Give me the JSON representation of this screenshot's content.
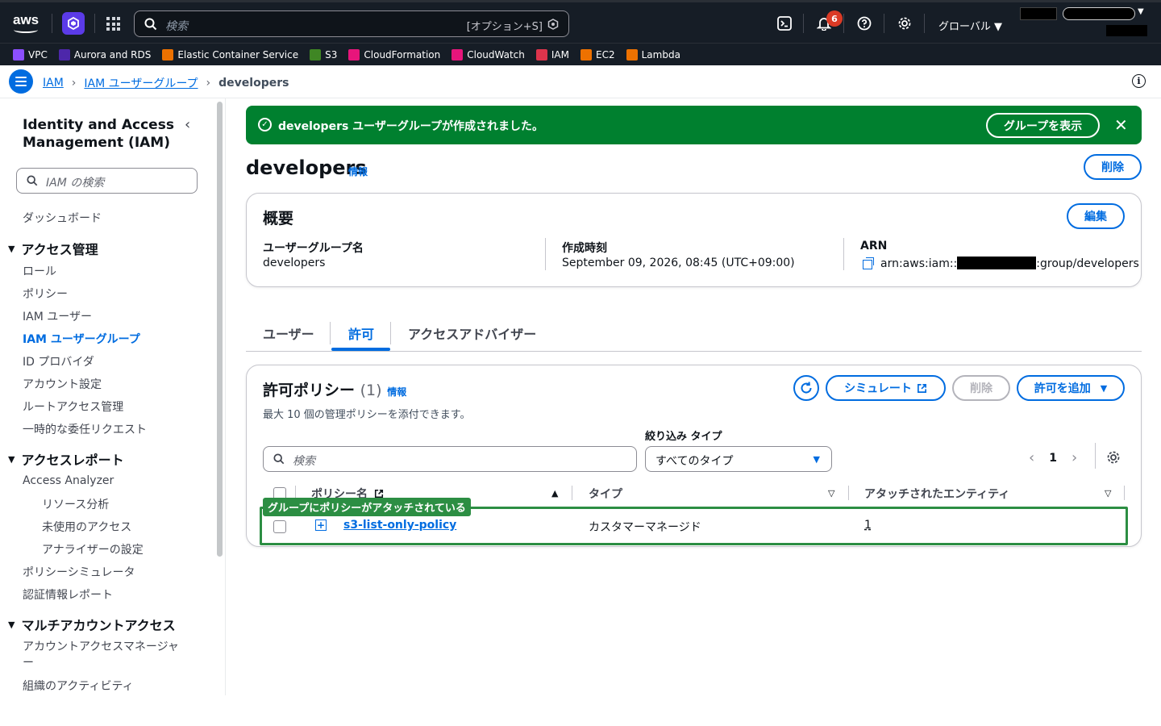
{
  "topbar": {
    "logo_text": "aws",
    "search_placeholder": "検索",
    "search_shortcut": "[オプション+S]",
    "notifications_count": "6",
    "region": "グローバル ▼"
  },
  "favorites": [
    {
      "label": "VPC",
      "color": "#8c4fff"
    },
    {
      "label": "Aurora and RDS",
      "color": "#4d27aa"
    },
    {
      "label": "Elastic Container Service",
      "color": "#ed7100"
    },
    {
      "label": "S3",
      "color": "#3f8624"
    },
    {
      "label": "CloudFormation",
      "color": "#e7157b"
    },
    {
      "label": "CloudWatch",
      "color": "#e7157b"
    },
    {
      "label": "IAM",
      "color": "#dd344c"
    },
    {
      "label": "EC2",
      "color": "#ed7100"
    },
    {
      "label": "Lambda",
      "color": "#ed7100"
    }
  ],
  "breadcrumb": {
    "items": [
      "IAM",
      "IAM ユーザーグループ"
    ],
    "current": "developers"
  },
  "sidebar": {
    "title": "Identity and Access Management (IAM)",
    "search_placeholder": "IAM の検索",
    "dashboard": "ダッシュボード",
    "section_access": "アクセス管理",
    "access_items": [
      "ロール",
      "ポリシー",
      "IAM ユーザー",
      "IAM ユーザーグループ",
      "ID プロバイダ",
      "アカウント設定",
      "ルートアクセス管理",
      "一時的な委任リクエスト"
    ],
    "section_reports": "アクセスレポート",
    "access_analyzer": "Access Analyzer",
    "analyzer_items": [
      "リソース分析",
      "未使用のアクセス",
      "アナライザーの設定"
    ],
    "report_items": [
      "ポリシーシミュレータ",
      "認証情報レポート"
    ],
    "section_multi": "マルチアカウントアクセス",
    "multi_items": [
      "アカウントアクセスマネージャー",
      "組織のアクティビティ"
    ]
  },
  "flash": {
    "message": "developers ユーザーグループが作成されました。",
    "button": "グループを表示"
  },
  "page": {
    "title": "developers",
    "info": "情報",
    "delete": "削除"
  },
  "summary": {
    "heading": "概要",
    "edit": "編集",
    "group_name_label": "ユーザーグループ名",
    "group_name": "developers",
    "created_label": "作成時刻",
    "created": "September 09, 2026, 08:45 (UTC+09:00)",
    "arn_label": "ARN",
    "arn_prefix": "arn:aws:iam::",
    "arn_suffix": ":group/developers"
  },
  "tabs": [
    "ユーザー",
    "許可",
    "アクセスアドバイザー"
  ],
  "permissions": {
    "heading": "許可ポリシー",
    "count": "(1)",
    "info": "情報",
    "description": "最大 10 個の管理ポリシーを添付できます。",
    "simulate": "シミュレート",
    "delete": "削除",
    "add": "許可を追加",
    "filter_label": "絞り込み タイプ",
    "search_placeholder": "検索",
    "filter_value": "すべてのタイプ",
    "page": "1",
    "columns": [
      "ポリシー名",
      "タイプ",
      "アタッチされたエンティティ"
    ],
    "annotation": "グループにポリシーがアタッチされている",
    "rows": [
      {
        "name": "s3-list-only-policy",
        "type": "カスタマーマネージド",
        "entities": "1"
      }
    ]
  }
}
